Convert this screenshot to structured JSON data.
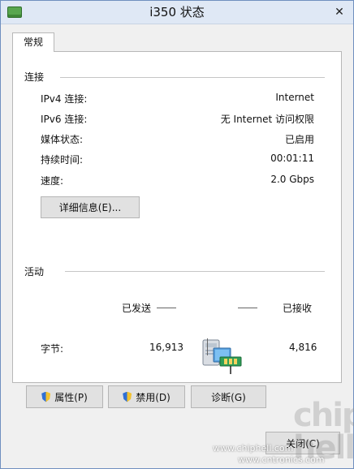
{
  "window": {
    "title": "i350 状态",
    "close_label": "✕",
    "tab_label": "常规"
  },
  "connection": {
    "section_title": "连接",
    "rows": [
      {
        "label": "IPv4 连接:",
        "value": "Internet"
      },
      {
        "label": "IPv6 连接:",
        "value": "无 Internet 访问权限"
      },
      {
        "label": "媒体状态:",
        "value": "已启用"
      },
      {
        "label": "持续时间:",
        "value": "00:01:11"
      },
      {
        "label": "速度:",
        "value": "2.0 Gbps"
      }
    ],
    "details_button": "详细信息(E)..."
  },
  "activity": {
    "section_title": "活动",
    "sent_label": "已发送",
    "received_label": "已接收",
    "bytes_label": "字节:",
    "bytes_sent": "16,913",
    "bytes_received": "4,816"
  },
  "buttons": {
    "properties": "属性(P)",
    "disable": "禁用(D)",
    "diagnose": "诊断(G)",
    "close": "关闭(C)"
  },
  "watermarks": {
    "logo": "chip hell",
    "site_1": "www.chiphell.com",
    "site_2": "www.cntronics.com"
  },
  "icons": {
    "window": "network-connection-icon",
    "shield": "uac-shield-icon",
    "network": "computer-network-icon"
  }
}
